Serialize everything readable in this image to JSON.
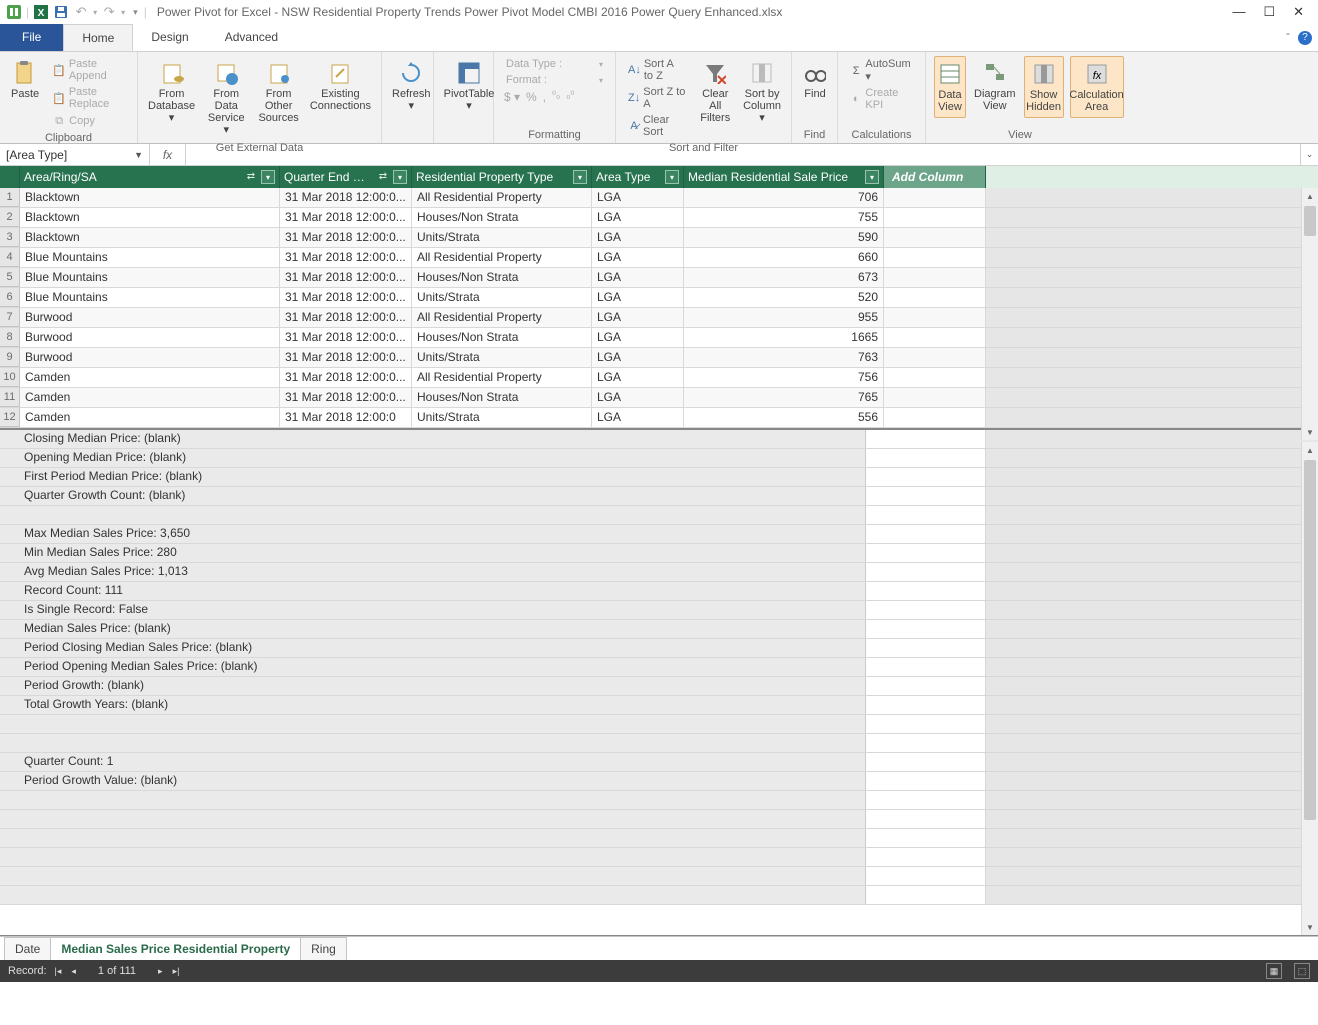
{
  "window": {
    "title": "Power Pivot for Excel - NSW Residential Property Trends Power Pivot Model CMBI 2016 Power Query Enhanced.xlsx"
  },
  "qat": {
    "undo": "↶",
    "redo": "↷"
  },
  "tabs": {
    "file": "File",
    "home": "Home",
    "design": "Design",
    "advanced": "Advanced"
  },
  "ribbon": {
    "clipboard": {
      "label": "Clipboard",
      "paste": "Paste",
      "append": "Paste Append",
      "replace": "Paste Replace",
      "copy": "Copy"
    },
    "getdata": {
      "label": "Get External Data",
      "fromdb": "From Database ▾",
      "fromsvc": "From Data Service ▾",
      "fromother": "From Other Sources",
      "existing": "Existing Connections"
    },
    "refresh": "Refresh ▾",
    "pivot": "PivotTable ▾",
    "formatting": {
      "label": "Formatting",
      "dtype": "Data Type :",
      "format": "Format :",
      "currency": "$ ▾",
      "percent": "%",
      "comma": ",",
      "inc": ".00→.0",
      "dec": ".0→.00"
    },
    "sortfilter": {
      "label": "Sort and Filter",
      "az": "Sort A to Z",
      "za": "Sort Z to A",
      "clear": "Clear Sort",
      "clearfilters1": "Clear All",
      "clearfilters2": "Filters",
      "sortby1": "Sort by",
      "sortby2": "Column ▾"
    },
    "find": {
      "label": "Find",
      "btn": "Find"
    },
    "calc": {
      "label": "Calculations",
      "autosum": "AutoSum ▾",
      "kpi": "Create KPI"
    },
    "view": {
      "label": "View",
      "data1": "Data",
      "data2": "View",
      "diag1": "Diagram",
      "diag2": "View",
      "show1": "Show",
      "show2": "Hidden",
      "calc1": "Calculation",
      "calc2": "Area"
    }
  },
  "namebox": "[Area Type]",
  "columns": {
    "area": "Area/Ring/SA",
    "qtr": "Quarter End …",
    "prop": "Residential Property Type",
    "atype": "Area Type",
    "med": "Median Residential Sale Price",
    "add": "Add Column"
  },
  "rows": [
    {
      "n": 1,
      "area": "Blacktown",
      "qtr": "31 Mar 2018 12:00:0...",
      "prop": "All Residential Property",
      "atype": "LGA",
      "med": "706"
    },
    {
      "n": 2,
      "area": "Blacktown",
      "qtr": "31 Mar 2018 12:00:0...",
      "prop": "Houses/Non Strata",
      "atype": "LGA",
      "med": "755"
    },
    {
      "n": 3,
      "area": "Blacktown",
      "qtr": "31 Mar 2018 12:00:0...",
      "prop": "Units/Strata",
      "atype": "LGA",
      "med": "590"
    },
    {
      "n": 4,
      "area": "Blue Mountains",
      "qtr": "31 Mar 2018 12:00:0...",
      "prop": "All Residential Property",
      "atype": "LGA",
      "med": "660"
    },
    {
      "n": 5,
      "area": "Blue Mountains",
      "qtr": "31 Mar 2018 12:00:0...",
      "prop": "Houses/Non Strata",
      "atype": "LGA",
      "med": "673"
    },
    {
      "n": 6,
      "area": "Blue Mountains",
      "qtr": "31 Mar 2018 12:00:0...",
      "prop": "Units/Strata",
      "atype": "LGA",
      "med": "520"
    },
    {
      "n": 7,
      "area": "Burwood",
      "qtr": "31 Mar 2018 12:00:0...",
      "prop": "All Residential Property",
      "atype": "LGA",
      "med": "955"
    },
    {
      "n": 8,
      "area": "Burwood",
      "qtr": "31 Mar 2018 12:00:0...",
      "prop": "Houses/Non Strata",
      "atype": "LGA",
      "med": "1665"
    },
    {
      "n": 9,
      "area": "Burwood",
      "qtr": "31 Mar 2018 12:00:0...",
      "prop": "Units/Strata",
      "atype": "LGA",
      "med": "763"
    },
    {
      "n": 10,
      "area": "Camden",
      "qtr": "31 Mar 2018 12:00:0...",
      "prop": "All Residential Property",
      "atype": "LGA",
      "med": "756"
    },
    {
      "n": 11,
      "area": "Camden",
      "qtr": "31 Mar 2018 12:00:0...",
      "prop": "Houses/Non Strata",
      "atype": "LGA",
      "med": "765"
    },
    {
      "n": 12,
      "area": "Camden",
      "qtr": "31 Mar 2018 12:00:0",
      "prop": "Units/Strata",
      "atype": "LGA",
      "med": "556"
    }
  ],
  "measures": [
    "Closing Median Price: (blank)",
    "Opening Median Price: (blank)",
    "First Period Median Price: (blank)",
    "Quarter Growth Count: (blank)",
    "",
    "Max Median Sales Price: 3,650",
    "Min Median Sales Price: 280",
    "Avg Median Sales Price: 1,013",
    "Record Count: 111",
    "Is Single Record: False",
    "Median Sales Price: (blank)",
    "Period Closing Median Sales Price: (blank)",
    "Period Opening Median Sales Price: (blank)",
    "Period Growth: (blank)",
    "Total Growth Years: (blank)",
    "",
    "",
    "Quarter Count: 1",
    "Period Growth Value: (blank)",
    "",
    "",
    "",
    "",
    "",
    ""
  ],
  "sheets": {
    "date": "Date",
    "median": "Median Sales Price Residential Property",
    "ring": "Ring"
  },
  "status": {
    "record": "Record:",
    "pos": "1 of 111"
  }
}
